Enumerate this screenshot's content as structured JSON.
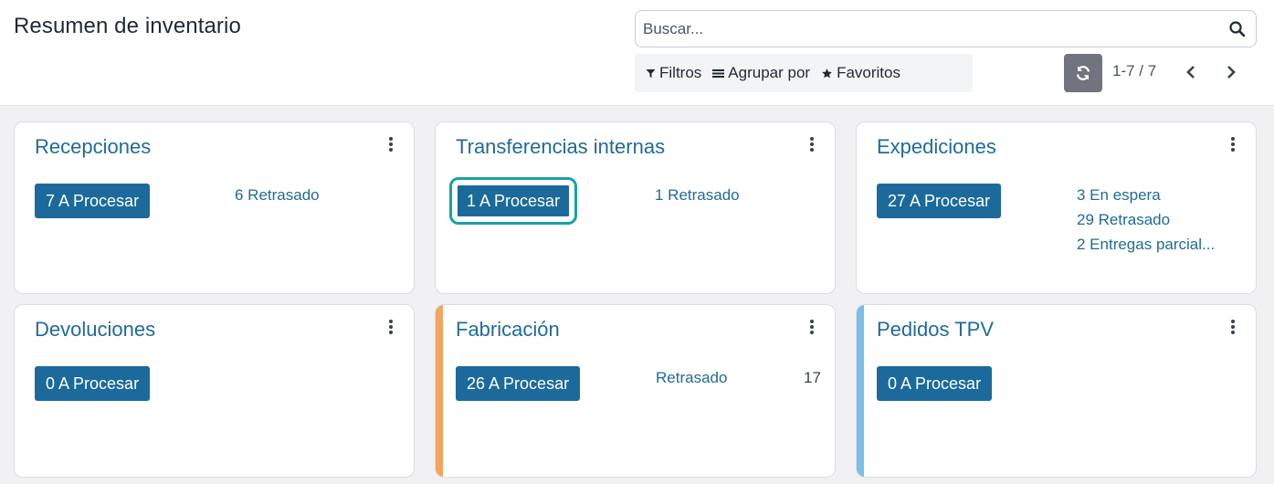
{
  "header": {
    "title": "Resumen de inventario",
    "search_placeholder": "Buscar...",
    "filters_label": "Filtros",
    "group_by_label": "Agrupar por",
    "favorites_label": "Favoritos",
    "pager_value": "1-7 / 7"
  },
  "cards": [
    {
      "title": "Recepciones",
      "button": "7 A Procesar",
      "stats": [
        "6 Retrasado"
      ]
    },
    {
      "title": "Transferencias internas",
      "button": "1 A Procesar",
      "stats": [
        "1 Retrasado"
      ]
    },
    {
      "title": "Expediciones",
      "button": "27 A Procesar",
      "stats": [
        "3 En espera",
        "29 Retrasado",
        "2 Entregas parcial..."
      ]
    },
    {
      "title": "Devoluciones",
      "button": "0 A Procesar",
      "stats": []
    },
    {
      "title": "Fabricación",
      "button": "26 A Procesar",
      "stats": [
        "Retrasado"
      ],
      "stat_value": "17",
      "stripe_color": "#f4a460"
    },
    {
      "title": "Pedidos TPV",
      "button": "0 A Procesar",
      "stats": [],
      "stripe_color": "#79bfe9"
    }
  ],
  "colors": {
    "primary": "#1b6a9b",
    "link": "#1f6b9a",
    "focus_ring": "#17a3a0",
    "refresh_button": "#71737f"
  }
}
